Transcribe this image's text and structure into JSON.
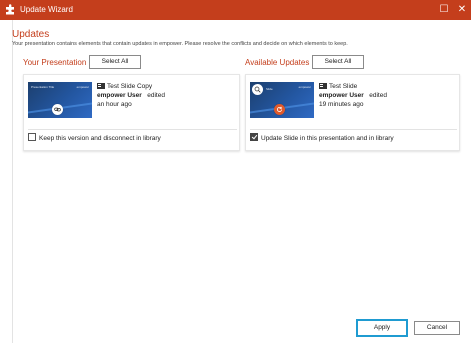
{
  "window": {
    "title": "Update Wizard",
    "accent_color": "#c43e1c",
    "controls": {
      "maximize_glyph": "☐",
      "close_glyph": "✕"
    }
  },
  "header": {
    "title": "Updates",
    "description": "Your presentation contains elements that contain updates in empower. Please resolve the conflicts and decide on which elements to keep."
  },
  "your_presentation": {
    "section_label": "Your Presentation",
    "select_all_label": "Select All",
    "card": {
      "thumbnail_title": "Presentation Title",
      "thumbnail_brand": "empower",
      "slide_name": "Test Slide Copy",
      "user": "empower User",
      "action": "edited",
      "time": "an hour ago",
      "checkbox_label": "Keep this version and disconnect in library",
      "checked": false,
      "badge_icon": "link-broken-icon"
    }
  },
  "available_updates": {
    "section_label": "Available Updates",
    "select_all_label": "Select All",
    "card": {
      "thumbnail_title": "Slide",
      "thumbnail_brand": "empower",
      "slide_name": "Test Slide",
      "user": "empower User",
      "action": "edited",
      "time": "19 minutes ago",
      "checkbox_label": "Update Slide in this presentation and in library",
      "checked": true,
      "badge_icon": "refresh-icon"
    }
  },
  "footer": {
    "apply_label": "Apply",
    "cancel_label": "Cancel",
    "focus_color": "#1f9bd1"
  }
}
